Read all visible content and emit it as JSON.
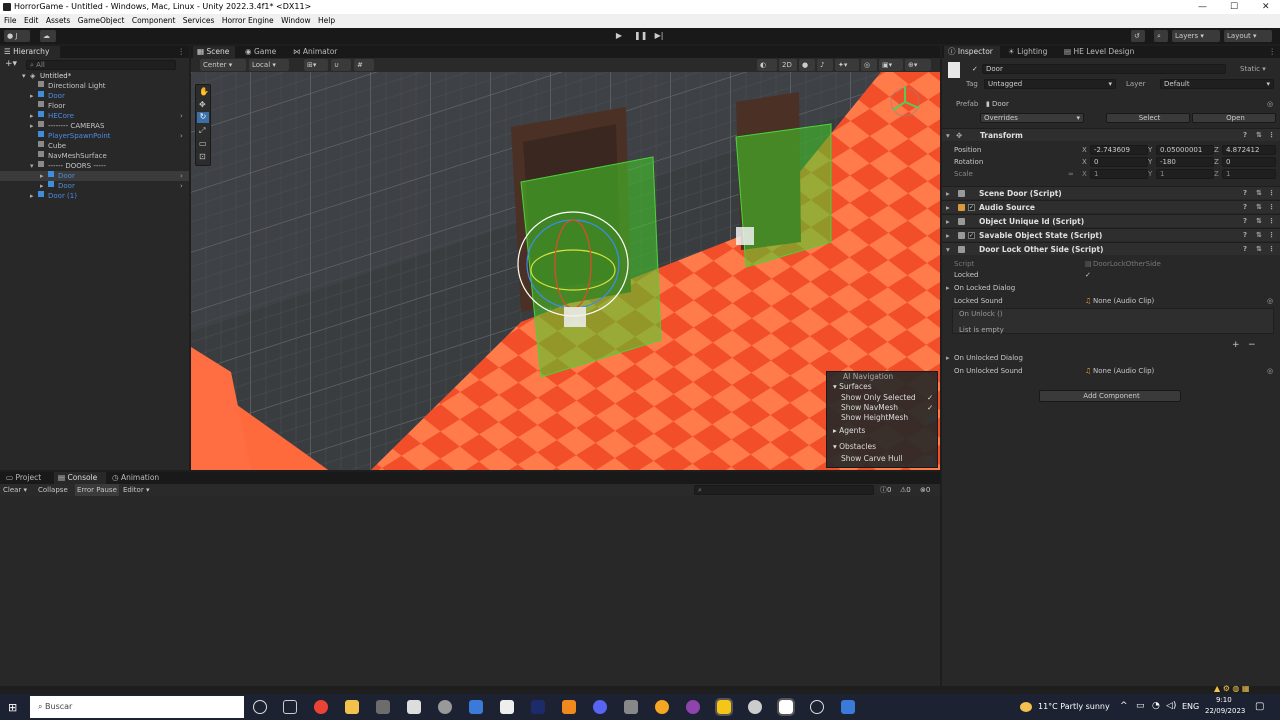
{
  "window": {
    "title": "HorrorGame - Untitled - Windows, Mac, Linux - Unity 2022.3.4f1* <DX11>"
  },
  "menu": [
    "File",
    "Edit",
    "Assets",
    "GameObject",
    "Component",
    "Services",
    "Horror Engine",
    "Window",
    "Help"
  ],
  "toolbar": {
    "account": "J",
    "layers": "Layers",
    "layout": "Layout"
  },
  "hierarchy": {
    "tab": "Hierarchy",
    "search": "All",
    "items": [
      {
        "label": "Untitled*",
        "indent": 0,
        "style": "scene"
      },
      {
        "label": "Directional Light",
        "indent": 1,
        "style": "normal"
      },
      {
        "label": "Door",
        "indent": 1,
        "style": "blue"
      },
      {
        "label": "Floor",
        "indent": 1,
        "style": "normal"
      },
      {
        "label": "HECore",
        "indent": 1,
        "style": "blue"
      },
      {
        "label": "-------- CAMERAS",
        "indent": 1,
        "style": "normal"
      },
      {
        "label": "PlayerSpawnPoint",
        "indent": 1,
        "style": "blue"
      },
      {
        "label": "Cube",
        "indent": 1,
        "style": "normal"
      },
      {
        "label": "NavMeshSurface",
        "indent": 1,
        "style": "normal"
      },
      {
        "label": "------ DOORS -----",
        "indent": 1,
        "style": "normal"
      },
      {
        "label": "Door",
        "indent": 2,
        "style": "blue-sel"
      },
      {
        "label": "Door",
        "indent": 2,
        "style": "blue"
      },
      {
        "label": "Door (1)",
        "indent": 1,
        "style": "blue"
      }
    ]
  },
  "scene": {
    "tabs": [
      "Scene",
      "Game",
      "Animator"
    ],
    "pivot": "Center",
    "space": "Local",
    "mode2d": "2D",
    "nav": {
      "title": "AI Navigation",
      "surfaces": "Surfaces",
      "show_only_selected": "Show Only Selected",
      "show_navmesh": "Show NavMesh",
      "show_heightmesh": "Show HeightMesh",
      "agents": "Agents",
      "obstacles": "Obstacles",
      "show_carve_hull": "Show Carve Hull"
    }
  },
  "inspector": {
    "tabs": [
      "Inspector",
      "Lighting",
      "HE Level Design"
    ],
    "name": "Door",
    "static": "Static",
    "tag_label": "Tag",
    "tag": "Untagged",
    "layer_label": "Layer",
    "layer": "Default",
    "prefab_label": "Prefab",
    "prefab": "Door",
    "overrides": "Overrides",
    "select": "Select",
    "open": "Open",
    "transform": "Transform",
    "position_label": "Position",
    "pos": {
      "x": "-2.743609",
      "y": "0.05000001",
      "z": "4.872412"
    },
    "rotation_label": "Rotation",
    "rot": {
      "x": "0",
      "y": "-180",
      "z": "0"
    },
    "scale_label": "Scale",
    "scl": {
      "x": "1",
      "y": "1",
      "z": "1"
    },
    "components": [
      "Scene Door (Script)",
      "Audio Source",
      "Object Unique Id (Script)",
      "Savable Object State (Script)",
      "Door Lock Other Side (Script)"
    ],
    "script_label": "Script",
    "script_value": "DoorLockOtherSide",
    "locked_label": "Locked",
    "on_locked_dialog": "On Locked Dialog",
    "locked_sound_label": "Locked Sound",
    "locked_sound": "None (Audio Clip)",
    "on_unlock": "On Unlock ()",
    "list_empty": "List is empty",
    "on_unlocked_dialog": "On Unlocked Dialog",
    "unlocked_sound_label": "On Unlocked Sound",
    "unlocked_sound": "None (Audio Clip)",
    "add_component": "Add Component"
  },
  "console": {
    "tabs": [
      "Project",
      "Console",
      "Animation"
    ],
    "clear": "Clear",
    "collapse": "Collapse",
    "error_pause": "Error Pause",
    "editor": "Editor",
    "count_log": "0",
    "count_warn": "0",
    "count_err": "0"
  },
  "taskbar": {
    "search": "Buscar",
    "weather": "11°C  Partly sunny",
    "lang": "ENG",
    "time": "9:10",
    "date": "22/09/2023"
  }
}
